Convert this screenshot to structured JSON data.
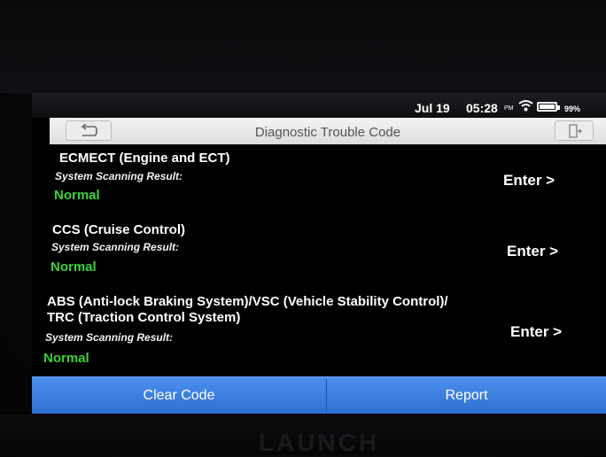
{
  "statusbar": {
    "date": "Jul 19",
    "time": "05:28",
    "ampm": "PM",
    "battery": "99%"
  },
  "header": {
    "title": "Diagnostic Trouble Code",
    "back_icon": "back-arrow-icon",
    "exit_icon": "exit-icon"
  },
  "systems": [
    {
      "title": "ECMECT (Engine and ECT)",
      "result_label": "System Scanning Result:",
      "status": "Normal",
      "action": "Enter >"
    },
    {
      "title": "CCS (Cruise Control)",
      "result_label": "System Scanning Result:",
      "status": "Normal",
      "action": "Enter >"
    },
    {
      "title_line1": "ABS (Anti-lock Braking System)/VSC (Vehicle Stability Control)/",
      "title_line2": "TRC (Traction Control System)",
      "result_label": "System Scanning Result:",
      "status": "Normal",
      "action": "Enter >"
    }
  ],
  "footer": {
    "clear_label": "Clear Code",
    "report_label": "Report"
  },
  "device": {
    "brand": "LAUNCH"
  },
  "colors": {
    "status_normal": "#39d13a",
    "button_bar": "#3a7de0"
  }
}
